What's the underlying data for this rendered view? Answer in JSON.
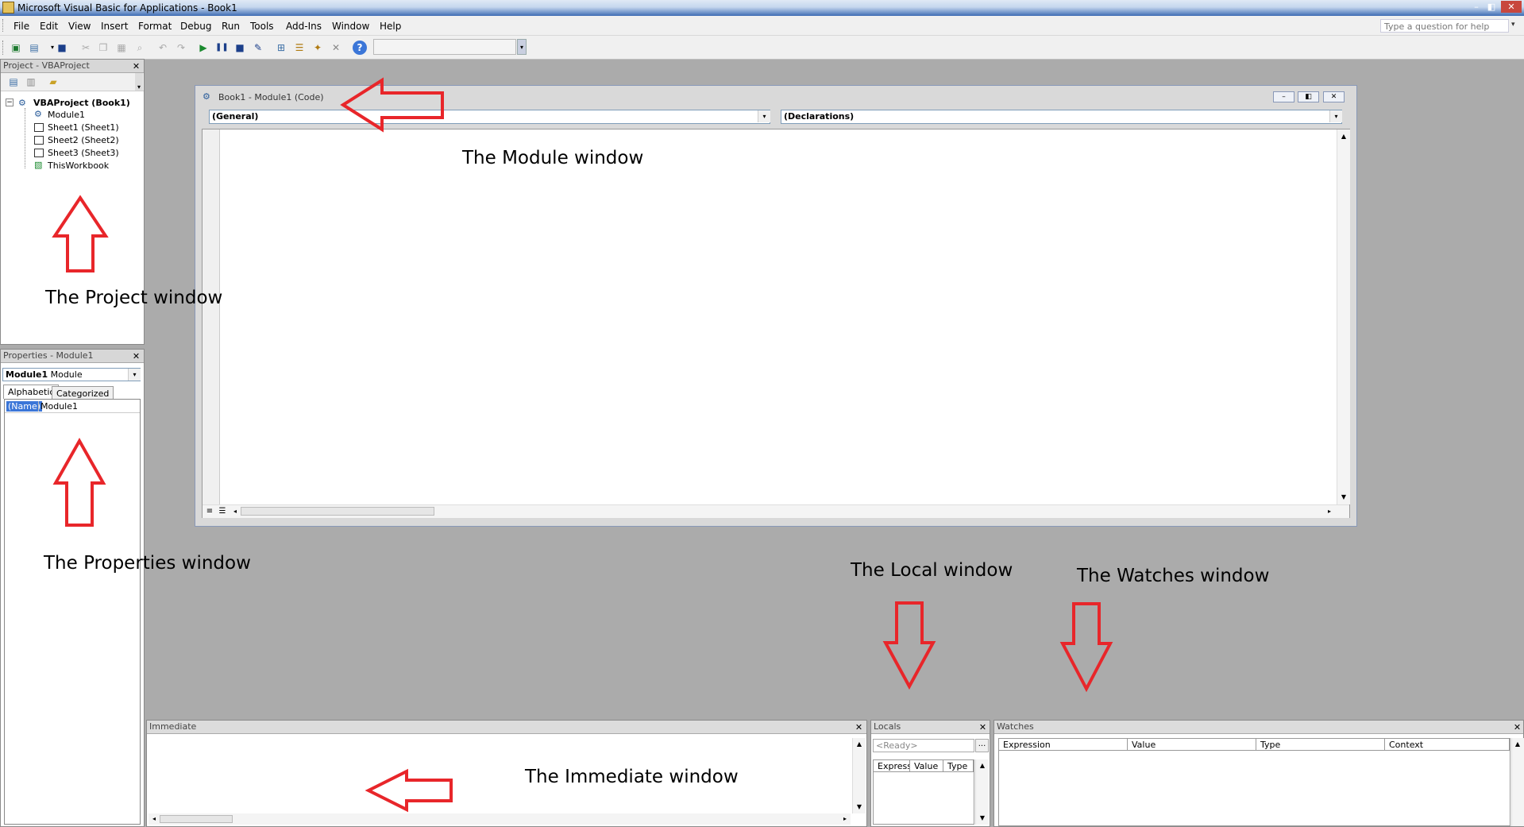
{
  "window": {
    "title": "Microsoft Visual Basic for Applications - Book1",
    "controls": [
      "–",
      "◧",
      "✕"
    ]
  },
  "menu": {
    "items": [
      "File",
      "Edit",
      "View",
      "Insert",
      "Format",
      "Debug",
      "Run",
      "Tools",
      "Add-Ins",
      "Window",
      "Help"
    ],
    "help_placeholder": "Type a question for help"
  },
  "toolbar": {
    "icons": [
      "excel-icon",
      "insert-userform-icon",
      "save-icon",
      "cut-icon",
      "copy-icon",
      "paste-icon",
      "find-icon",
      "undo-icon",
      "redo-icon",
      "run-icon",
      "break-icon",
      "reset-icon",
      "design-mode-icon",
      "project-explorer-icon",
      "properties-icon",
      "object-browser-icon",
      "toolbox-icon",
      "help-icon"
    ]
  },
  "project": {
    "title": "Project - VBAProject",
    "root": "VBAProject (Book1)",
    "items": [
      "Module1",
      "Sheet1 (Sheet1)",
      "Sheet2 (Sheet2)",
      "Sheet3 (Sheet3)",
      "ThisWorkbook"
    ]
  },
  "properties": {
    "title": "Properties - Module1",
    "object_name": "Module1",
    "object_type": "Module",
    "tabs": [
      "Alphabetic",
      "Categorized"
    ],
    "row_name": "(Name)",
    "row_value": "Module1"
  },
  "module": {
    "title": "Book1 - Module1 (Code)",
    "object_combo": "(General)",
    "proc_combo": "(Declarations)"
  },
  "immediate": {
    "title": "Immediate"
  },
  "locals": {
    "title": "Locals",
    "status": "<Ready>",
    "ellipsis": "...",
    "columns": [
      "Express",
      "Value",
      "Type"
    ]
  },
  "watches": {
    "title": "Watches",
    "columns": [
      "Expression",
      "Value",
      "Type",
      "Context"
    ]
  },
  "annotations": {
    "module": "The Module window",
    "project": "The Project window",
    "properties": "The Properties window",
    "local": "The Local window",
    "watches": "The Watches window",
    "immediate": "The Immediate window"
  },
  "colors": {
    "arrow": "#e8262a",
    "selection": "#3b76d8"
  }
}
